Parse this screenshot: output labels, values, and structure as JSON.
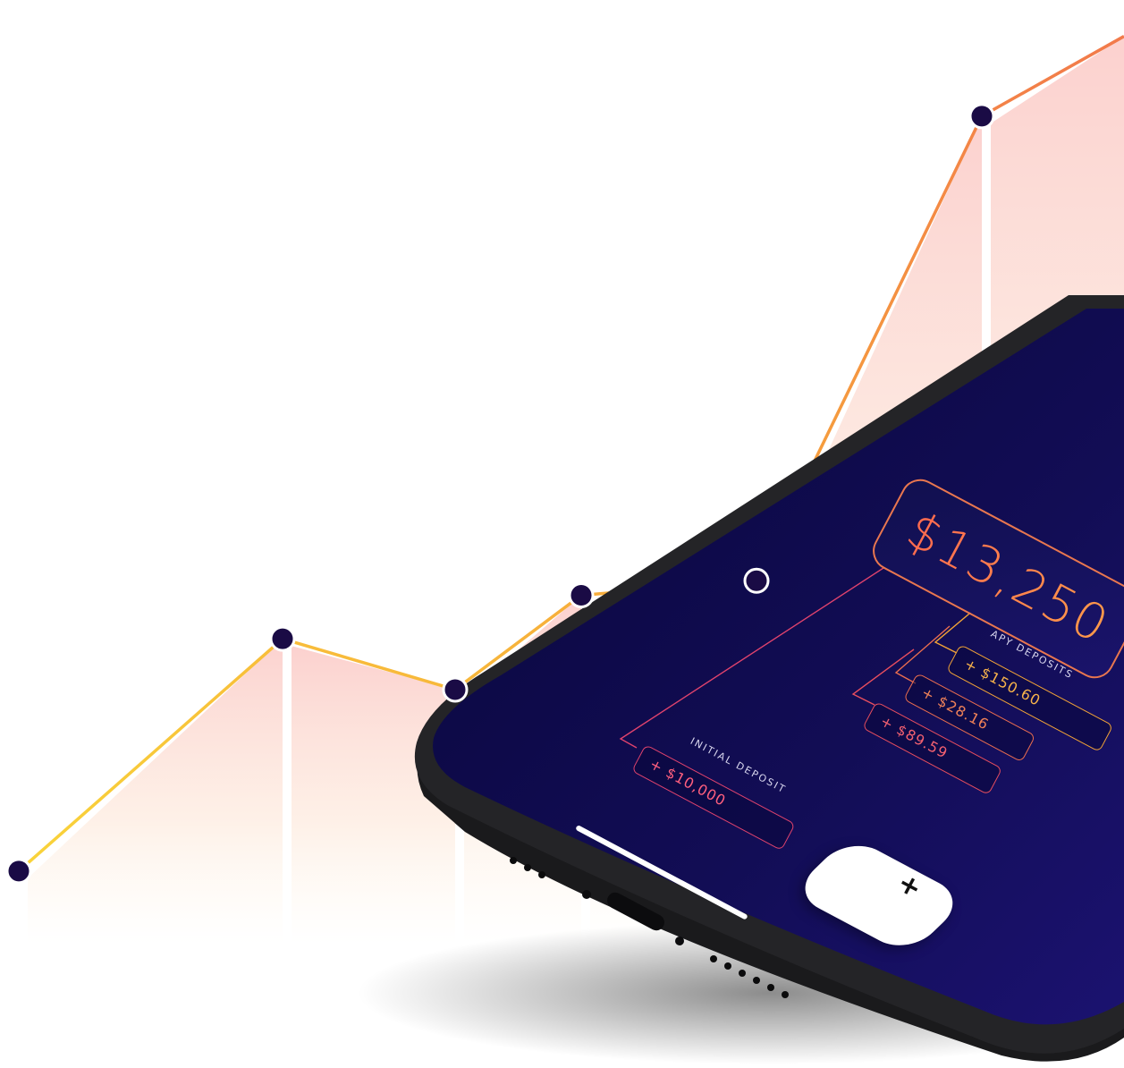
{
  "screen": {
    "balance": "$13,250",
    "initial_deposit": {
      "label": "INITIAL DEPOSIT",
      "amount": "+ $10,000"
    },
    "apy_deposits": {
      "label": "APY DEPOSITS",
      "items": [
        "+ $150.60",
        "+ $28.16",
        "+ $89.59"
      ]
    },
    "add_button_icon": "plus-icon",
    "add_button_glyph": "+"
  },
  "colors": {
    "screen_bg": "#0e0b4a",
    "phone_body": "#1c1c1e",
    "line_start": "#f9d43a",
    "line_end": "#f27a4b",
    "marker": "#1a0b45",
    "pill_initial": "#e0436d",
    "pill_apy_1": "#f3a436",
    "pill_apy_2": "#ec6e4f",
    "pill_apy_3": "#e84e5e",
    "balance_text": "#ff7a4f"
  },
  "decor_chart": {
    "type": "line",
    "x": [
      0,
      1,
      2,
      3,
      4,
      5,
      6
    ],
    "values": [
      1.0,
      4.2,
      3.5,
      4.8,
      5.0,
      11.4,
      12.5
    ],
    "ylim": [
      0,
      13
    ],
    "grid": false,
    "legend": "none"
  }
}
